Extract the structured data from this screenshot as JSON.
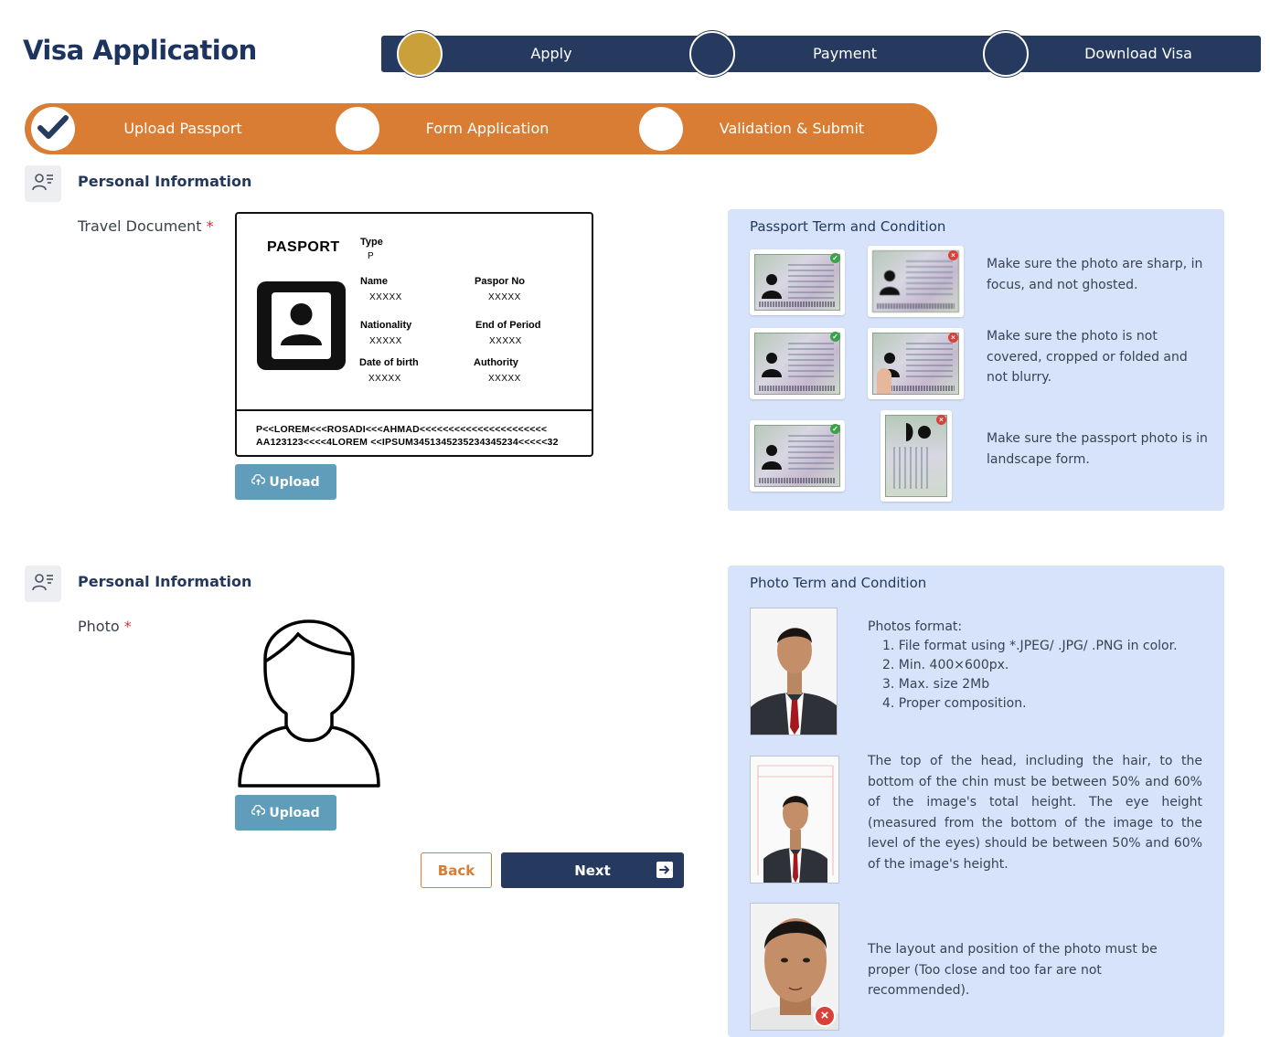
{
  "header": {
    "title": "Visa Application",
    "steps": [
      {
        "label": "Apply",
        "active": true
      },
      {
        "label": "Payment",
        "active": false
      },
      {
        "label": "Download Visa",
        "active": false
      }
    ]
  },
  "substeps": [
    {
      "label": "Upload Passport",
      "done": true
    },
    {
      "label": "Form Application",
      "done": false
    },
    {
      "label": "Validation & Submit",
      "done": false
    }
  ],
  "passport_section": {
    "title": "Personal Information",
    "field_label": "Travel Document",
    "required_mark": "*",
    "upload_label": "Upload",
    "card": {
      "title": "PASPORT",
      "type_label": "Type",
      "type_value": "P",
      "name_label": "Name",
      "name_value": "XXXXX",
      "pasport_no_label": "Paspor No",
      "pasport_no_value": "XXXXX",
      "nationality_label": "Nationality",
      "nationality_value": "XXXXX",
      "end_period_label": "End of Period",
      "end_period_value": "XXXXX",
      "dob_label": "Date of birth",
      "dob_value": "XXXXX",
      "authority_label": "Authority",
      "authority_value": "XXXXX",
      "mrz_line1": "P<<LOREM<<<ROSADI<<<AHMAD<<<<<<<<<<<<<<<<<<<<<<",
      "mrz_line2": "AA123123<<<<4LOREM <<IPSUM3451345235234345234<<<<<32"
    }
  },
  "passport_terms": {
    "title": "Passport Term and Condition",
    "rows": [
      {
        "text": "Make sure the photo are sharp, in focus, and not ghosted."
      },
      {
        "text": "Make sure the photo is not covered, cropped or folded and not blurry."
      },
      {
        "text": "Make sure the passport photo is in landscape form."
      }
    ],
    "ok_symbol": "✓",
    "bad_symbol": "×"
  },
  "photo_section": {
    "title": "Personal Information",
    "field_label": "Photo",
    "required_mark": "*",
    "upload_label": "Upload"
  },
  "photo_terms": {
    "title": "Photo Term and Condition",
    "format_heading": "Photos format:",
    "format_items": [
      "1. File format using *.JPEG/ .JPG/ .PNG in color.",
      "2. Min. 400×600px.",
      "3. Max. size 2Mb",
      "4. Proper composition."
    ],
    "head_rule": "The top of the head, including the hair, to the bottom of the chin must be between 50% and 60% of the image's total height. The eye height (measured from the bottom of the image to the level of the eyes) should be between 50% and 60% of the image's height.",
    "layout_rule": "The layout and position of the photo must be proper (Too close and too far are not recommended)."
  },
  "actions": {
    "back_label": "Back",
    "next_label": "Next"
  },
  "colors": {
    "navy": "#253a5e",
    "gold": "#c9a03a",
    "orange": "#d87d33",
    "upload_blue": "#5f9dbb",
    "panel_bg": "#d6e3fb"
  }
}
